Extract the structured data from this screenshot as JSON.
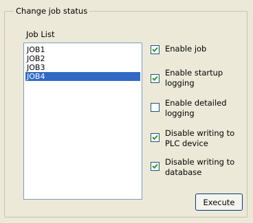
{
  "group": {
    "title": "Change job status"
  },
  "job_list": {
    "label": "Job List",
    "items": [
      "JOB1",
      "JOB2",
      "JOB3",
      "JOB4"
    ],
    "selected_index": 3
  },
  "options": [
    {
      "label": "Enable job",
      "checked": true
    },
    {
      "label": "Enable startup\nlogging",
      "checked": true
    },
    {
      "label": "Enable detailed\nlogging",
      "checked": false
    },
    {
      "label": "Disable writing to\nPLC device",
      "checked": true
    },
    {
      "label": "Disable writing to\ndatabase",
      "checked": true
    }
  ],
  "execute_label": "Execute"
}
